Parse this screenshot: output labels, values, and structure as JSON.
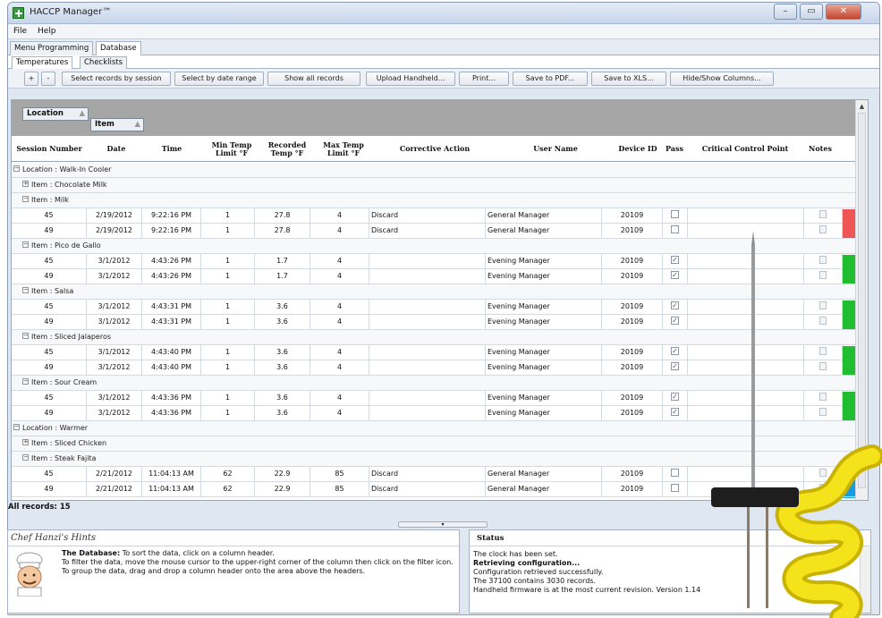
{
  "window": {
    "title": "HACCP Manager™"
  },
  "menu": [
    {
      "label": "File"
    },
    {
      "label": "Help"
    }
  ],
  "tabs": [
    {
      "label": "Menu Programming"
    },
    {
      "label": "Database"
    }
  ],
  "subtabs": [
    {
      "label": "Temperatures"
    },
    {
      "label": "Checklists"
    }
  ],
  "toolbar": {
    "expand": "+",
    "collapse": "-",
    "select_session": "Select records by session",
    "select_date": "Select by date range",
    "show_all": "Show all records",
    "upload": "Upload Handheld...",
    "print": "Print...",
    "pdf": "Save to PDF...",
    "xls": "Save to XLS...",
    "hide_show": "Hide/Show Columns..."
  },
  "grouping": {
    "location": "Location",
    "item": "Item"
  },
  "columns": {
    "session": "Session Number",
    "date": "Date",
    "time": "Time",
    "min_temp": "Min Temp Limit °F",
    "recorded": "Recorded Temp °F",
    "max_temp": "Max Temp Limit °F",
    "corrective": "Corrective Action",
    "user": "User Name",
    "device": "Device ID",
    "pass": "Pass",
    "ccp": "Critical Control Point",
    "notes": "Notes"
  },
  "groups": {
    "loc1": "Location : Walk-In Cooler",
    "choc": "Item : Chocolate Milk",
    "milk": "Item : Milk",
    "pico": "Item : Pico de Gallo",
    "salsa": "Item : Salsa",
    "jal": "Item : Sliced Jalaperos",
    "sour": "Item : Sour Cream",
    "loc2": "Location : Warmer",
    "chicken": "Item : Sliced Chicken",
    "fajita": "Item : Steak Fajita"
  },
  "records": [
    {
      "session": "45",
      "date": "2/19/2012",
      "time": "9:22:16 PM",
      "min": "1",
      "temp": "27.8",
      "max": "4",
      "action": "Discard",
      "user": "General Manager",
      "device": "20109",
      "pass": false
    },
    {
      "session": "49",
      "date": "2/19/2012",
      "time": "9:22:16 PM",
      "min": "1",
      "temp": "27.8",
      "max": "4",
      "action": "Discard",
      "user": "General Manager",
      "device": "20109",
      "pass": false
    },
    {
      "session": "45",
      "date": "3/1/2012",
      "time": "4:43:26 PM",
      "min": "1",
      "temp": "1.7",
      "max": "4",
      "action": "",
      "user": "Evening Manager",
      "device": "20109",
      "pass": true
    },
    {
      "session": "49",
      "date": "3/1/2012",
      "time": "4:43:26 PM",
      "min": "1",
      "temp": "1.7",
      "max": "4",
      "action": "",
      "user": "Evening Manager",
      "device": "20109",
      "pass": true
    },
    {
      "session": "45",
      "date": "3/1/2012",
      "time": "4:43:31 PM",
      "min": "1",
      "temp": "3.6",
      "max": "4",
      "action": "",
      "user": "Evening Manager",
      "device": "20109",
      "pass": true
    },
    {
      "session": "49",
      "date": "3/1/2012",
      "time": "4:43:31 PM",
      "min": "1",
      "temp": "3.6",
      "max": "4",
      "action": "",
      "user": "Evening Manager",
      "device": "20109",
      "pass": true
    },
    {
      "session": "45",
      "date": "3/1/2012",
      "time": "4:43:40 PM",
      "min": "1",
      "temp": "3.6",
      "max": "4",
      "action": "",
      "user": "Evening Manager",
      "device": "20109",
      "pass": true
    },
    {
      "session": "49",
      "date": "3/1/2012",
      "time": "4:43:40 PM",
      "min": "1",
      "temp": "3.6",
      "max": "4",
      "action": "",
      "user": "Evening Manager",
      "device": "20109",
      "pass": true
    },
    {
      "session": "45",
      "date": "3/1/2012",
      "time": "4:43:36 PM",
      "min": "1",
      "temp": "3.6",
      "max": "4",
      "action": "",
      "user": "Evening Manager",
      "device": "20109",
      "pass": true
    },
    {
      "session": "49",
      "date": "3/1/2012",
      "time": "4:43:36 PM",
      "min": "1",
      "temp": "3.6",
      "max": "4",
      "action": "",
      "user": "Evening Manager",
      "device": "20109",
      "pass": true
    },
    {
      "session": "45",
      "date": "2/21/2012",
      "time": "11:04:13 AM",
      "min": "62",
      "temp": "22.9",
      "max": "85",
      "action": "Discard",
      "user": "General Manager",
      "device": "20109",
      "pass": false
    },
    {
      "session": "49",
      "date": "2/21/2012",
      "time": "11:04:13 AM",
      "min": "62",
      "temp": "22.9",
      "max": "85",
      "action": "Discard",
      "user": "General Manager",
      "device": "20109",
      "pass": false
    }
  ],
  "pass_colors": {
    "fail": "#ee5555",
    "pass": "#1fbd2f",
    "other": "#1a9be0"
  },
  "record_count": "All records: 15",
  "hints": {
    "title": "Chef Hanzi's Hints",
    "heading": "The Database:",
    "line1": "To sort the data, click on a column header.",
    "line2": "To filter the data, move the mouse cursor to the upper-right corner of the column then click on the filter icon.",
    "line3": "To group the data, drag and drop a column header onto the area above the headers."
  },
  "status": {
    "title": "Status",
    "lines": [
      "The clock has been set.",
      "Retrieving configuration...",
      "Configuration retrieved successfully.",
      "The 37100 contains 3030 records.",
      "Handheld firmware is at the most current revision. Version 1.14"
    ]
  }
}
